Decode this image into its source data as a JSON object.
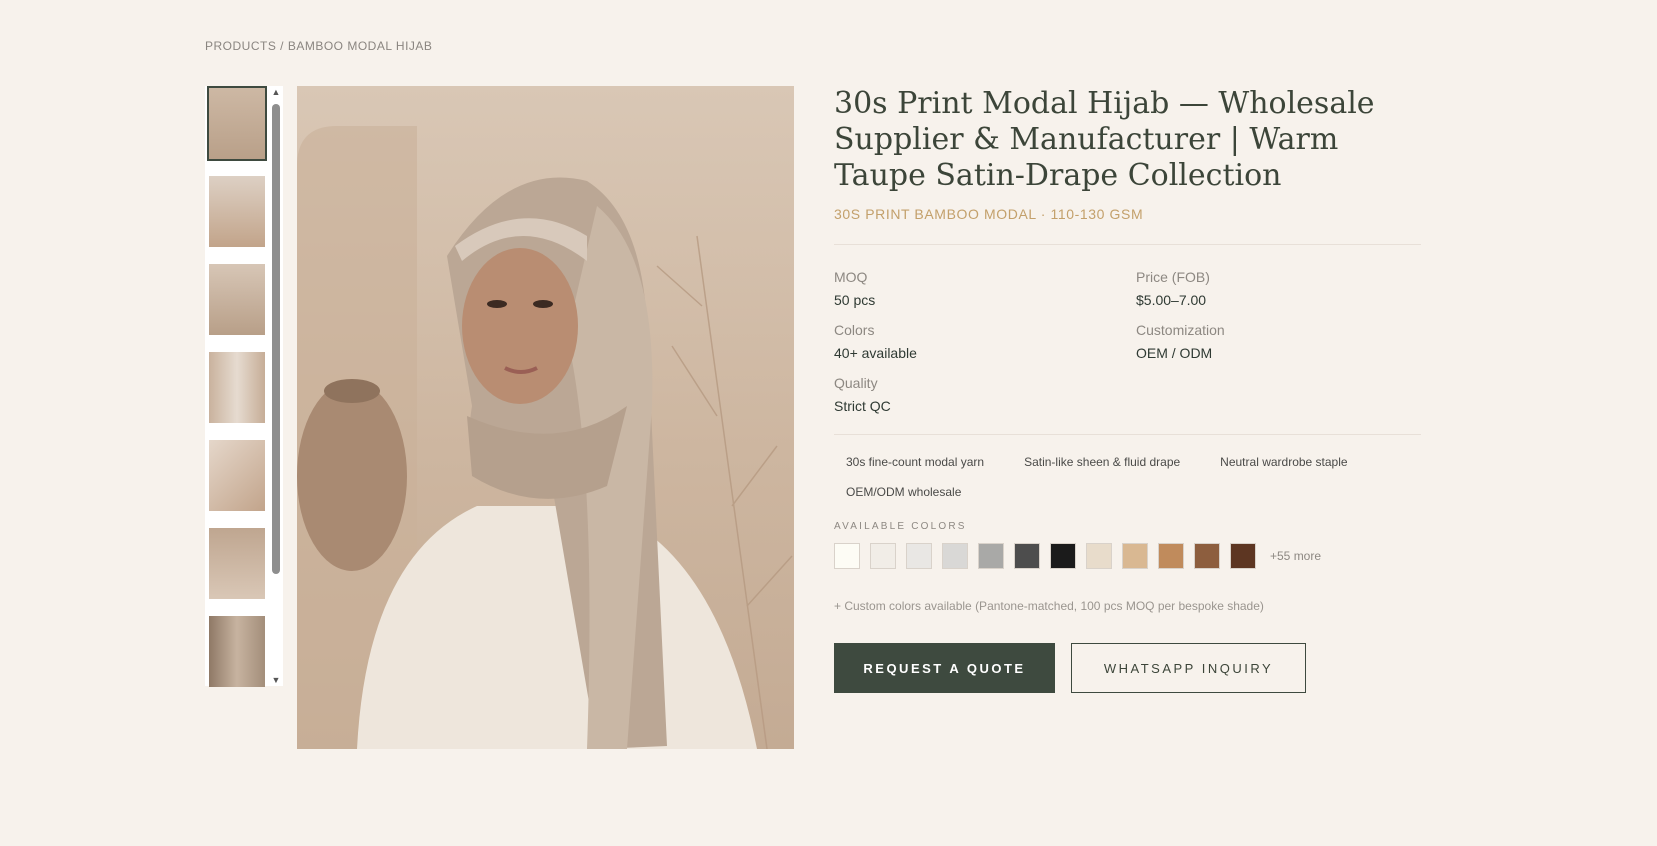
{
  "breadcrumb": "PRODUCTS / BAMBOO MODAL HIJAB",
  "gallery": {
    "thumbnail_count": 7,
    "active_index": 0,
    "scroll_up_icon": "▲",
    "scroll_down_icon": "▼"
  },
  "product": {
    "title": "30s Print Modal Hijab — Wholesale Supplier & Manufacturer | Warm Taupe Satin-Drape Collection",
    "subtitle": "30S PRINT BAMBOO MODAL · 110-130 GSM",
    "specs": [
      {
        "label": "MOQ",
        "value": "50 pcs"
      },
      {
        "label": "Price (FOB)",
        "value": "$5.00–7.00"
      },
      {
        "label": "Colors",
        "value": "40+ available"
      },
      {
        "label": "Customization",
        "value": "OEM / ODM"
      },
      {
        "label": "Quality",
        "value": "Strict QC"
      }
    ],
    "tags": [
      "30s fine-count modal yarn",
      "Satin-like sheen & fluid drape",
      "Neutral wardrobe staple",
      "OEM/ODM wholesale"
    ],
    "colors_heading": "AVAILABLE COLORS",
    "swatches": [
      "#fdfcf5",
      "#f1ede7",
      "#e9e7e4",
      "#d9d8d6",
      "#a9a9a7",
      "#4d4d4d",
      "#1b1b1b",
      "#e8dccb",
      "#d9b892",
      "#c08b5c",
      "#8d5e3e",
      "#5d3622"
    ],
    "more_colors": "+55 more",
    "custom_note": "+ Custom colors available (Pantone-matched, 100 pcs MOQ per bespoke shade)"
  },
  "actions": {
    "primary": "REQUEST A QUOTE",
    "secondary": "WHATSAPP INQUIRY"
  },
  "colors": {
    "accent_dark": "#3e4a3f",
    "accent_gold": "#c3a06b",
    "background": "#f7f2ec"
  }
}
